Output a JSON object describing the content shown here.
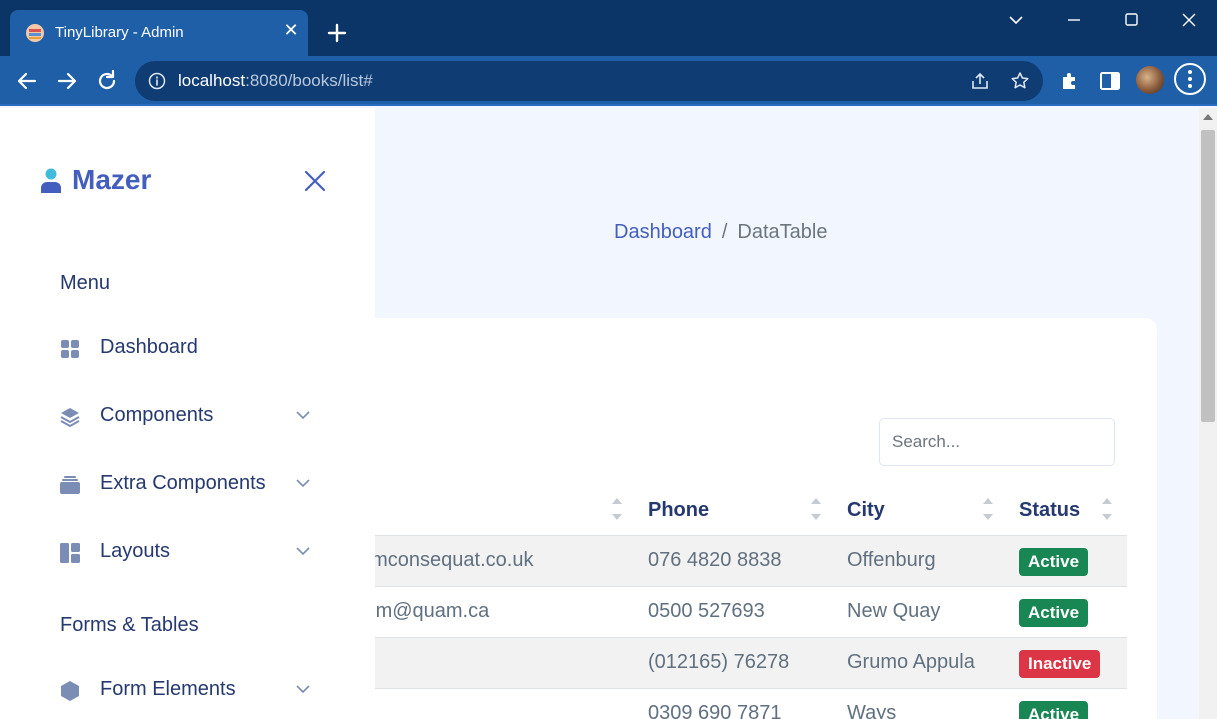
{
  "browser": {
    "tab_title": "TinyLibrary - Admin",
    "url_host": "localhost",
    "url_rest": ":8080/books/list#"
  },
  "sidebar": {
    "brand": "Mazer",
    "sections": [
      {
        "title": "Menu"
      },
      {
        "title": "Forms & Tables"
      }
    ],
    "items": [
      {
        "label": "Dashboard",
        "icon": "grid-icon",
        "has_submenu": false
      },
      {
        "label": "Components",
        "icon": "stack-icon",
        "has_submenu": true
      },
      {
        "label": "Extra Components",
        "icon": "collection-icon",
        "has_submenu": true
      },
      {
        "label": "Layouts",
        "icon": "layout-icon",
        "has_submenu": true
      },
      {
        "label": "Form Elements",
        "icon": "hexagon-icon",
        "has_submenu": true
      }
    ]
  },
  "breadcrumb": {
    "home": "Dashboard",
    "separator": "/",
    "current": "DataTable"
  },
  "datatable": {
    "search_placeholder": "Search...",
    "columns": [
      "Phone",
      "City",
      "Status"
    ],
    "rows": [
      {
        "email": "emconsequat.co.uk",
        "phone": "076 4820 8838",
        "city": "Offenburg",
        "status": "Active"
      },
      {
        "email": "nim@quam.ca",
        "phone": "0500 527693",
        "city": "New Quay",
        "status": "Active"
      },
      {
        "email": "",
        "phone": "(012165) 76278",
        "city": "Grumo Appula",
        "status": "Inactive"
      },
      {
        "email": "",
        "phone": "0309 690 7871",
        "city": "Ways",
        "status": "Active"
      }
    ]
  },
  "colors": {
    "primary": "#435ebe",
    "heading": "#25396f",
    "active": "#198754",
    "inactive": "#dc3545",
    "chrome_dark": "#0b3566",
    "chrome_toolbar": "#1f5fa8"
  }
}
